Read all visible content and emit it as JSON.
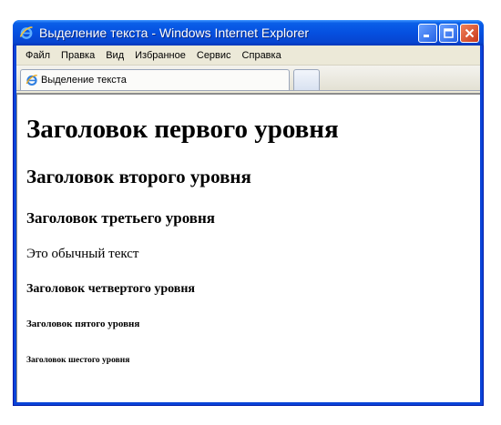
{
  "window": {
    "title": "Выделение текста - Windows Internet Explorer",
    "icon": "ie-icon",
    "controls": [
      "minimize-icon",
      "maximize-icon",
      "close-icon"
    ]
  },
  "menu": {
    "items": [
      "Файл",
      "Правка",
      "Вид",
      "Избранное",
      "Сервис",
      "Справка"
    ]
  },
  "tabs": [
    {
      "label": "Выделение текста",
      "icon": "ie-icon"
    }
  ],
  "page": {
    "h1": "Заголовок первого уровня",
    "h2": "Заголовок второго уровня",
    "h3": "Заголовок третьего уровня",
    "paragraph": "Это обычный текст",
    "h4": "Заголовок четвертого уровня",
    "h5": "Заголовок пятого уровня",
    "h6": "Заголовок шестого уровня"
  },
  "colors": {
    "titlebar": "#0550e0",
    "close_button": "#c8391c",
    "chrome": "#ece9d8"
  }
}
